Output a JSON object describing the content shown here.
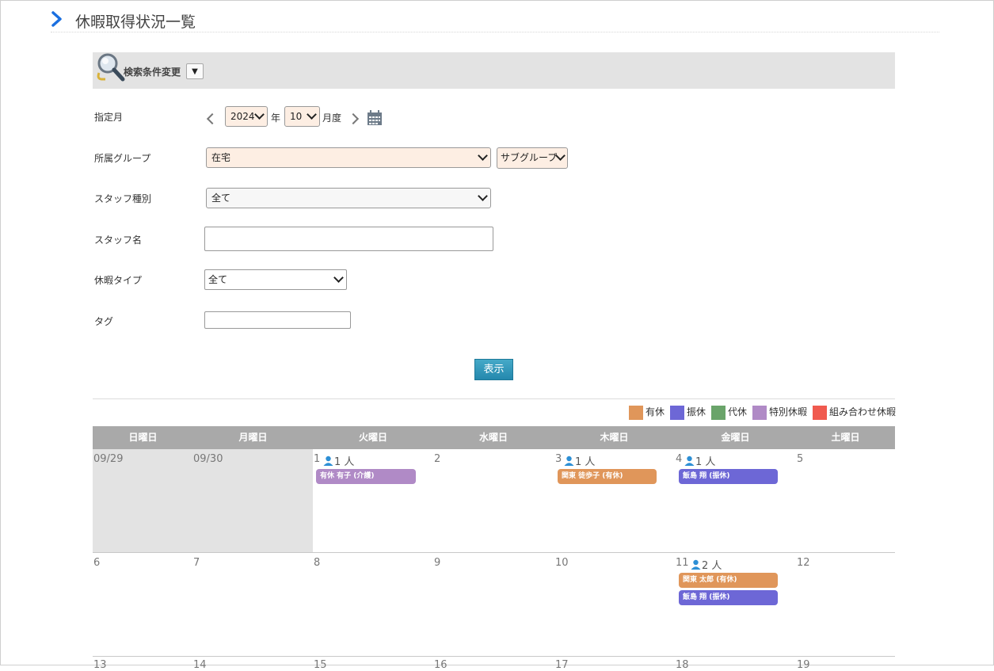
{
  "page_title": "休暇取得状況一覧",
  "search": {
    "label": "検索条件変更",
    "toggle": "▼"
  },
  "form": {
    "month_label": "指定月",
    "year_value": "2024",
    "year_unit": "年",
    "month_value": "10",
    "month_unit": "月度",
    "group_label": "所属グループ",
    "group_value": "在宅",
    "subgroup_value": "サブグループ",
    "staff_type_label": "スタッフ種別",
    "staff_type_value": "全て",
    "staff_name_label": "スタッフ名",
    "staff_name_value": "",
    "leave_type_label": "休暇タイプ",
    "leave_type_value": "全て",
    "tag_label": "タグ",
    "tag_value": "",
    "show_button": "表示"
  },
  "legend": [
    {
      "label": "有休",
      "color": "#e0965a"
    },
    {
      "label": "振休",
      "color": "#6d67d6"
    },
    {
      "label": "代休",
      "color": "#6aa46a"
    },
    {
      "label": "特別休暇",
      "color": "#b08ac6"
    },
    {
      "label": "組み合わせ休暇",
      "color": "#f05a4f"
    }
  ],
  "calendar": {
    "weekdays": [
      "日曜日",
      "月曜日",
      "火曜日",
      "水曜日",
      "木曜日",
      "金曜日",
      "土曜日"
    ],
    "week1": {
      "days": [
        "09/29",
        "09/30",
        "1",
        "2",
        "3",
        "4",
        "5"
      ],
      "counts": {
        "tue": "1 人",
        "thu": "1 人",
        "fri": "1 人"
      },
      "events": {
        "tue": "有休 有子 (介護)",
        "thu": "関東 徒歩子 (有休)",
        "fri": "飯島 翔 (振休)"
      }
    },
    "week2": {
      "days": [
        "6",
        "7",
        "8",
        "9",
        "10",
        "11",
        "12"
      ],
      "counts": {
        "fri": "2 人"
      },
      "events": {
        "fri1": "関東 太郎 (有休)",
        "fri2": "飯島 翔 (振休)"
      }
    },
    "week3": {
      "days": [
        "13",
        "14",
        "15",
        "16",
        "17",
        "18",
        "19"
      ]
    }
  },
  "colors": {
    "accent": "#1a73e8",
    "button": "#2a92b5",
    "header": "#a9a9a9"
  }
}
